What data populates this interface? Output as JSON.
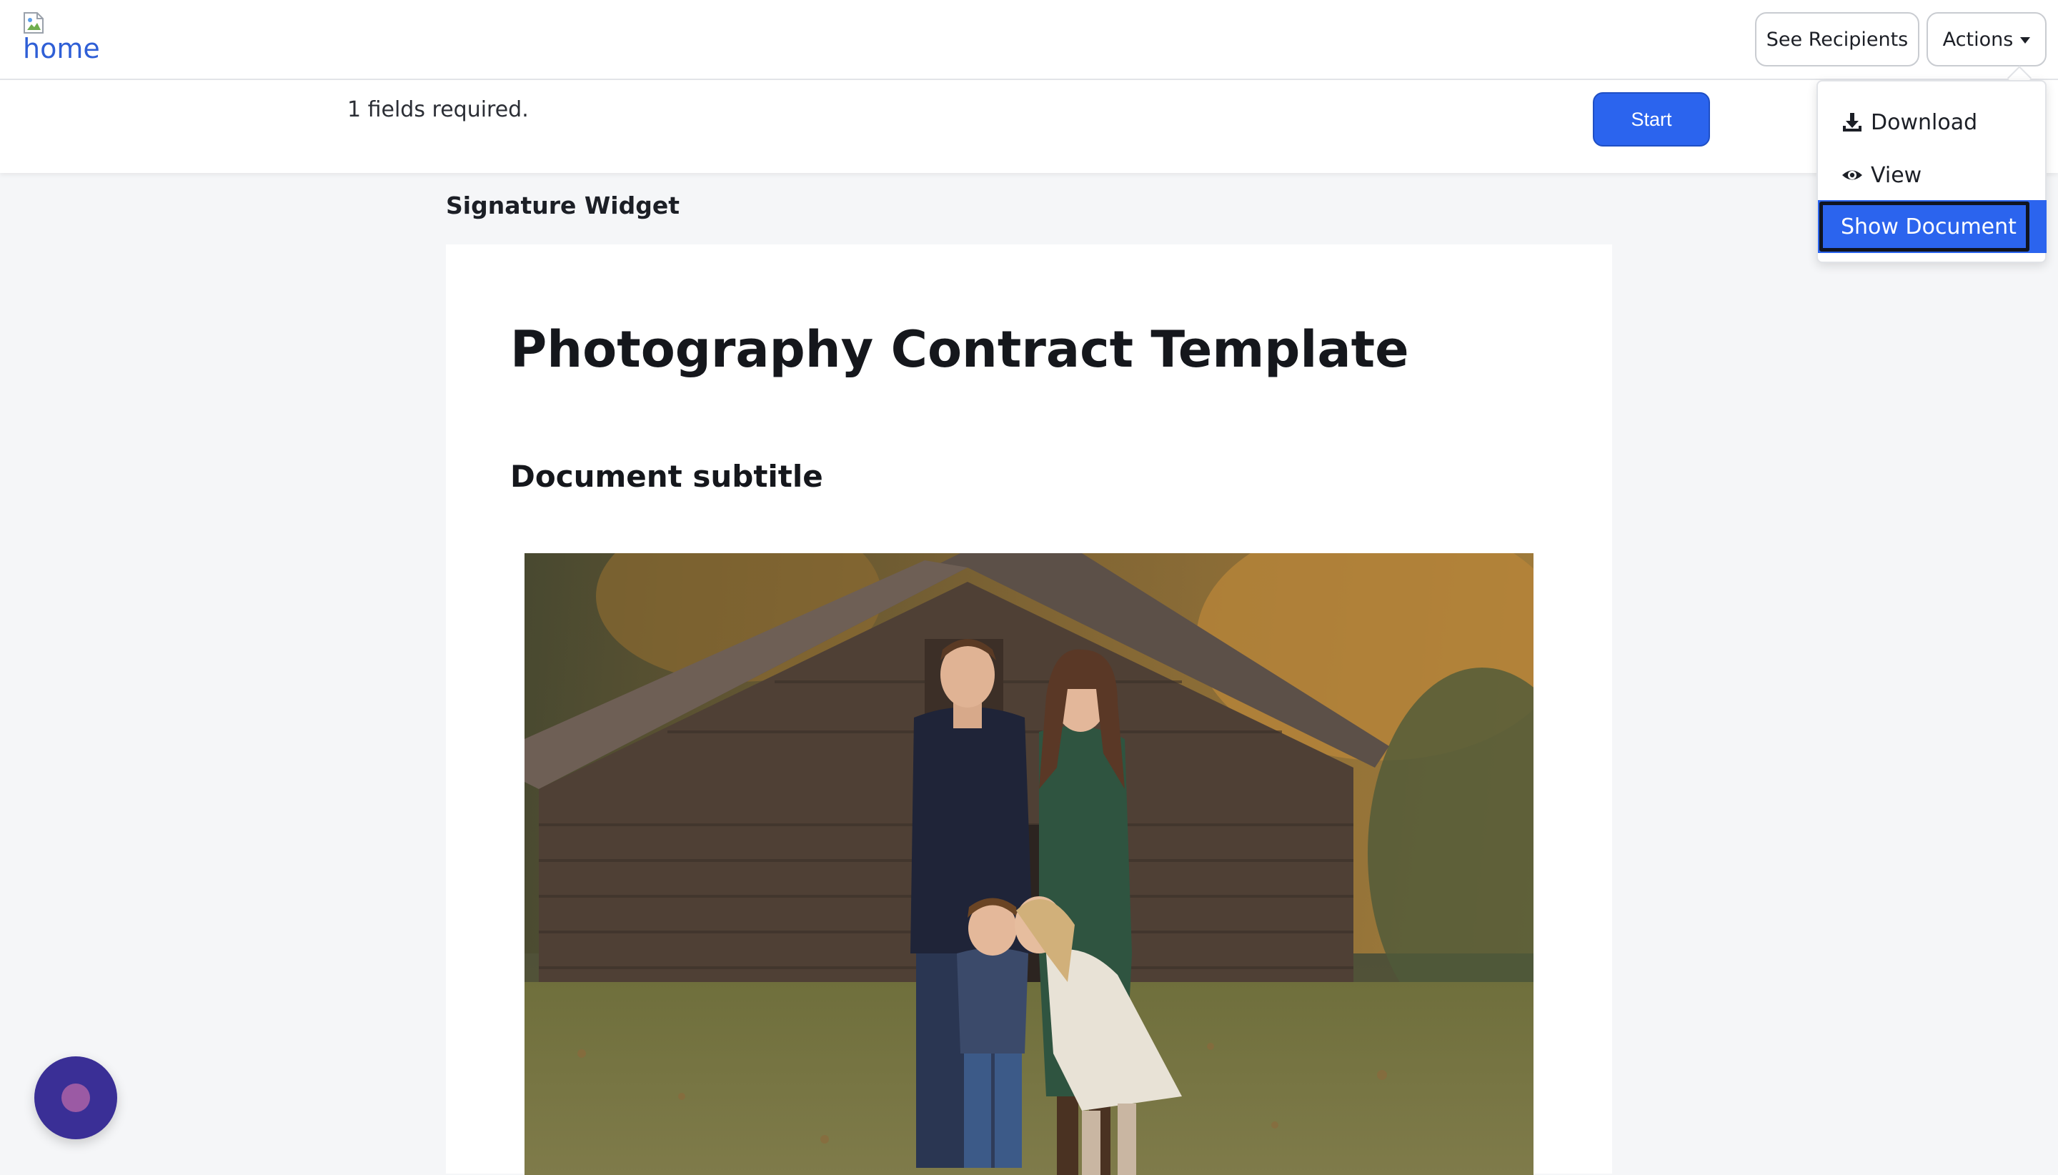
{
  "header": {
    "logo_alt": "home",
    "see_recipients_label": "See Recipients",
    "actions_label": "Actions"
  },
  "actions_menu": {
    "items": [
      {
        "label": "Download",
        "icon": "download-icon"
      },
      {
        "label": "View",
        "icon": "eye-icon"
      },
      {
        "label": "Show Document",
        "icon": "",
        "state": "highlighted"
      }
    ]
  },
  "subbar": {
    "fields_required": "1 fields required.",
    "start_label": "Start"
  },
  "widget": {
    "label": "Signature Widget"
  },
  "document": {
    "title": "Photography Contract Template",
    "subtitle": "Document subtitle",
    "image_subject": "family-portrait-photo"
  },
  "colors": {
    "primary": "#2b64ee",
    "chat_bubble": "#3a2f96",
    "logo_link": "#2f5fd6"
  }
}
